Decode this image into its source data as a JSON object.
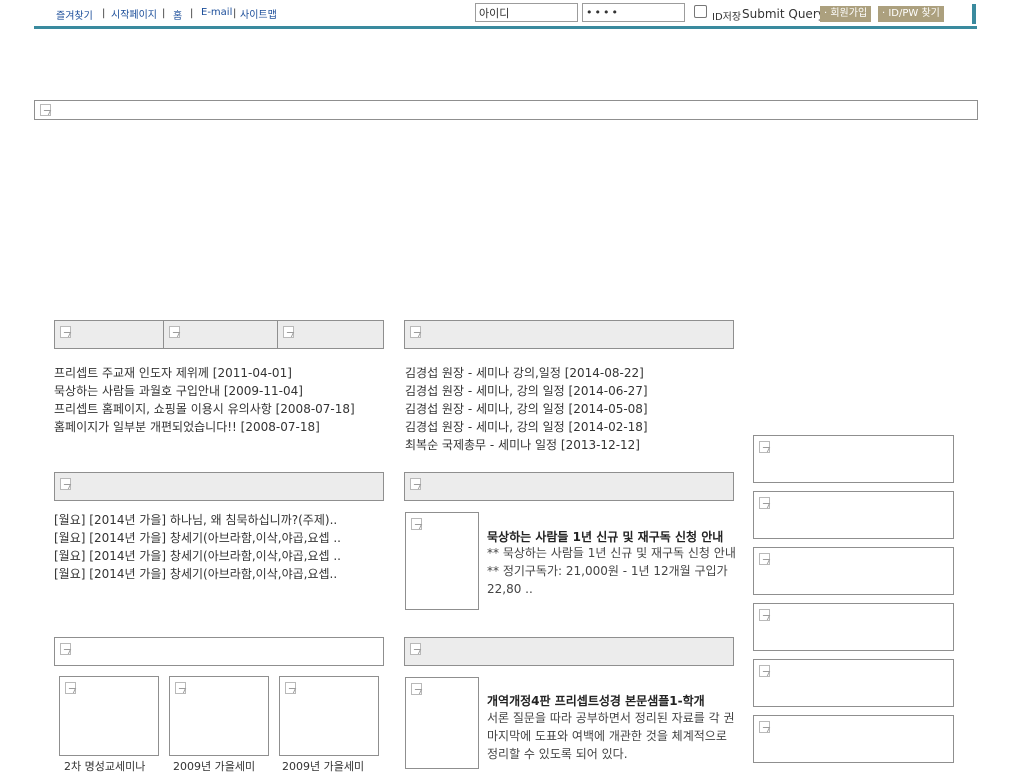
{
  "topnav": {
    "items": [
      "즐겨찾기",
      "시작페이지",
      "홈",
      "E-mail",
      "사이트맵"
    ],
    "separator": "|"
  },
  "login": {
    "id_value": "아이디",
    "pw_value": "••••",
    "remember_label": "ID저장",
    "submit_label": "Submit Query",
    "join_label": "· 회원가입",
    "find_label": "· ID/PW 찾기"
  },
  "notices": [
    "프리셉트 주교재 인도자 제위께 [2011-04-01]",
    "묵상하는 사람들 과월호 구입안내 [2009-11-04]",
    "프리셉트 홈페이지, 쇼핑몰 이용시 유의사항 [2008-07-18]",
    "홈페이지가 일부분 개편되었습니다!! [2008-07-18]"
  ],
  "seminars": [
    "김경섭 원장 - 세미나 강의,일정 [2014-08-22]",
    "김경섭 원장 - 세미나, 강의 일정 [2014-06-27]",
    "김경섭 원장 - 세미나, 강의 일정 [2014-05-08]",
    "김경섭 원장 - 세미나, 강의 일정 [2014-02-18]",
    "최복순 국제총무 - 세미나 일정 [2013-12-12]"
  ],
  "monthly": [
    "[월요] [2014년 가을] 하나님, 왜 침묵하십니까?(주제)..",
    "[월요] [2014년 가을] 창세기(아브라함,이삭,야곱,요셉 ..",
    "[월요] [2014년 가을] 창세기(아브라함,이삭,야곱,요셉 ..",
    "[월요] [2014년 가을] 창세기(아브라함,이삭,야곱,요셉.."
  ],
  "featured1": {
    "title": "묵상하는 사람들 1년 신규 및 재구독 신청 안내",
    "line1": "** 묵상하는 사람들 1년 신규 및 재구독 신청 안내",
    "line2": "** 정기구독가: 21,000원  - 1년 12개월 구입가",
    "line3": "22,80 .."
  },
  "featured2": {
    "title": "개역개정4판 프리셉트성경 본문샘플1-학개",
    "line1": "서론 질문을 따라 공부하면서 정리된 자료를 각 권",
    "line2": "마지막에 도표와 여백에 개관한 것을 체계적으로",
    "line3": "정리할 수 있도록 되어 있다."
  },
  "gallery": [
    "2차 명성교세미나",
    "2009년 가을세미",
    "2009년 가을세미"
  ],
  "colors": {
    "accent": "#3a8a9e",
    "link": "#1c4e9a",
    "header_bg": "#ececec",
    "button": "#aca07e"
  }
}
